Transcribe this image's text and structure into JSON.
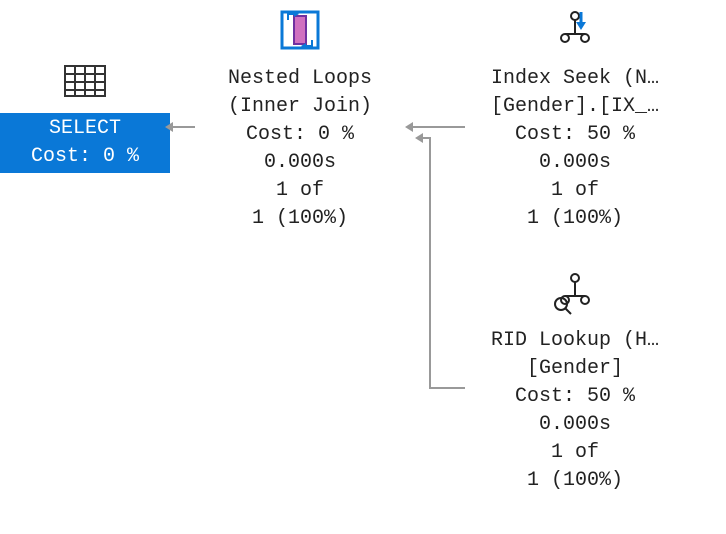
{
  "nodes": {
    "select": {
      "title": "SELECT",
      "cost": "Cost: 0 %"
    },
    "nested": {
      "title": "Nested Loops",
      "subtitle": "(Inner Join)",
      "cost": "Cost: 0 %",
      "time": "0.000s",
      "rows1": "1 of",
      "rows2": "1 (100%)"
    },
    "seek": {
      "title": "Index Seek (N…",
      "subtitle": "[Gender].[IX_…",
      "cost": "Cost: 50 %",
      "time": "0.000s",
      "rows1": "1 of",
      "rows2": "1 (100%)"
    },
    "lookup": {
      "title": "RID Lookup (H…",
      "subtitle": "[Gender]",
      "cost": "Cost: 50 %",
      "time": "0.000s",
      "rows1": "1 of",
      "rows2": "1 (100%)"
    }
  }
}
